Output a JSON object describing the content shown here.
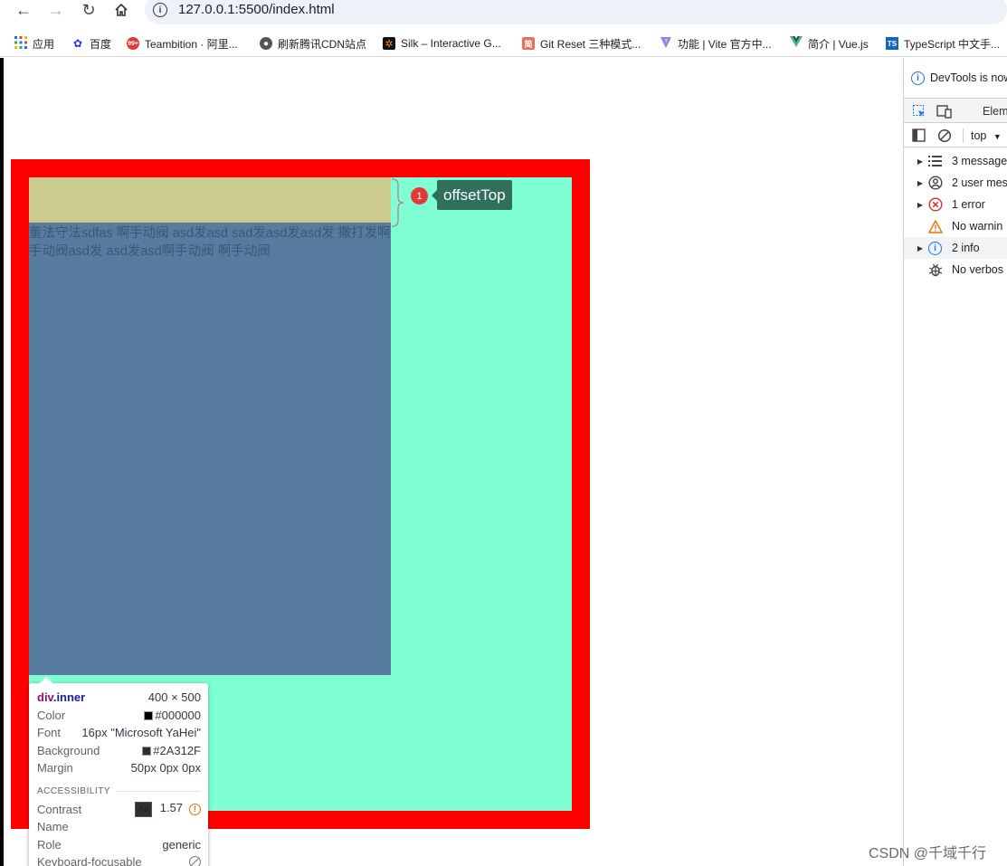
{
  "browser": {
    "url": "127.0.0.1:5500/index.html",
    "bookmarks": [
      {
        "label": "应用",
        "icon": "apps-grid-icon"
      },
      {
        "label": "百度",
        "icon": "baidu-paw-icon"
      },
      {
        "label": "Teambition · 阿里...",
        "icon": "teambition-icon"
      },
      {
        "label": "刷新腾讯CDN站点",
        "icon": "globe-icon"
      },
      {
        "label": "Silk – Interactive G...",
        "icon": "silk-icon"
      },
      {
        "label": "Git Reset 三种模式...",
        "icon": "jianshu-icon"
      },
      {
        "label": "功能 | Vite 官方中...",
        "icon": "vite-icon"
      },
      {
        "label": "简介 | Vue.js",
        "icon": "vue-icon"
      },
      {
        "label": "TypeScript 中文手...",
        "icon": "typescript-icon"
      }
    ]
  },
  "page": {
    "inner_text": "董法守法sdfas 啊手动阀 asd发asd sad发asd发asd发 撒打发啊手动阀asd发 asd发asd啊手动阀 啊手动阀",
    "annotation_number": "1",
    "annotation_label": "offsetTop",
    "colors": {
      "outer_border": "#ff0000",
      "outer_bg": "#7fffd4",
      "inner_bg": "#577c9f",
      "margin_highlight": "#ccca8f"
    }
  },
  "inspect_tooltip": {
    "selector_tag": "div",
    "selector_class": ".inner",
    "size": "400 × 500",
    "rows": [
      {
        "label": "Color",
        "value": "#000000",
        "swatch": "#000000"
      },
      {
        "label": "Font",
        "value": "16px \"Microsoft YaHei\""
      },
      {
        "label": "Background",
        "value": "#2A312F",
        "swatch": "#2A312F"
      },
      {
        "label": "Margin",
        "value": "50px 0px 0px"
      }
    ],
    "accessibility_header": "ACCESSIBILITY",
    "contrast_label": "Contrast",
    "contrast_sample": "Aa",
    "contrast_value": "1.57",
    "name_label": "Name",
    "role_label": "Role",
    "role_value": "generic",
    "focusable_label": "Keyboard-focusable"
  },
  "devtools": {
    "notice": "DevTools is now",
    "tab_elements": "Eleme",
    "context": "top",
    "messages": [
      {
        "label": "3 message",
        "icon": "list-icon",
        "expandable": true
      },
      {
        "label": "2 user mes",
        "icon": "user-icon",
        "expandable": true
      },
      {
        "label": "1 error",
        "icon": "error-icon",
        "expandable": true
      },
      {
        "label": "No warnin",
        "icon": "warning-icon",
        "expandable": false
      },
      {
        "label": "2 info",
        "icon": "info-icon",
        "expandable": true
      },
      {
        "label": "No verbos",
        "icon": "bug-icon",
        "expandable": false
      }
    ]
  },
  "watermark": "CSDN @千域千行"
}
